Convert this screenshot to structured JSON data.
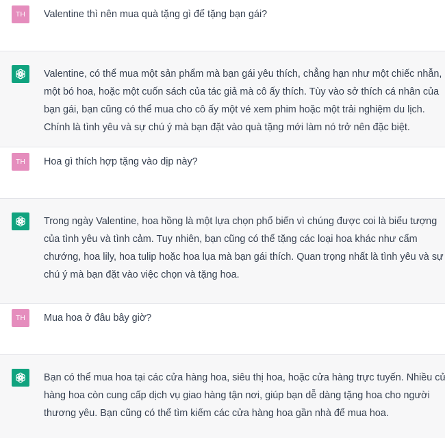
{
  "conversation": {
    "user_avatar": "TH",
    "assistant_avatar_icon": "openai-logo-icon",
    "colors": {
      "user_avatar_bg": "#e58dbd",
      "assistant_avatar_bg": "#10a37f",
      "assistant_row_bg": "#f7f7f8",
      "text": "#374151"
    },
    "turns": [
      {
        "role": "user",
        "lines": [
          "Valentine thì nên mua quà tặng gì để tặng bạn gái?"
        ]
      },
      {
        "role": "assistant",
        "lines": [
          "Valentine, có thể mua một sản phẩm mà bạn gái yêu thích, chẳng hạn như một chiếc nhẫn,",
          "một bó hoa, hoặc một cuốn sách của tác giả mà cô ấy thích. Tùy vào sở thích cá nhân của",
          "bạn gái, bạn cũng có thể mua cho cô ấy một vé xem phim hoặc một trải nghiệm du lịch.",
          "Chính là tình yêu và sự chú ý mà bạn đặt vào quà tặng mới làm nó trở nên đặc biệt."
        ]
      },
      {
        "role": "user",
        "lines": [
          "Hoa gì thích hợp tặng vào dịp này?"
        ]
      },
      {
        "role": "assistant",
        "lines": [
          "Trong ngày Valentine, hoa hồng là một lựa chọn phổ biến vì chúng được coi là biểu tượng",
          "của tình yêu và tình cảm. Tuy nhiên, bạn cũng có thể tặng các loại hoa khác như cẩm",
          "chướng, hoa lily, hoa tulip hoặc hoa lụa mà bạn gái thích. Quan trọng nhất là tình yêu và sự",
          "chú ý mà bạn đặt vào việc chọn và tặng hoa."
        ]
      },
      {
        "role": "user",
        "lines": [
          "Mua hoa ở đâu bây giờ?"
        ]
      },
      {
        "role": "assistant",
        "lines": [
          "Bạn có thể mua hoa tại các cửa hàng hoa, siêu thị hoa, hoặc cửa hàng trực tuyến. Nhiều cửa",
          "hàng hoa còn cung cấp dịch vụ giao hàng tận nơi, giúp bạn dễ dàng tặng hoa cho người",
          "thương yêu. Bạn cũng có thể tìm kiếm các cửa hàng hoa gần nhà để mua hoa."
        ]
      }
    ]
  }
}
